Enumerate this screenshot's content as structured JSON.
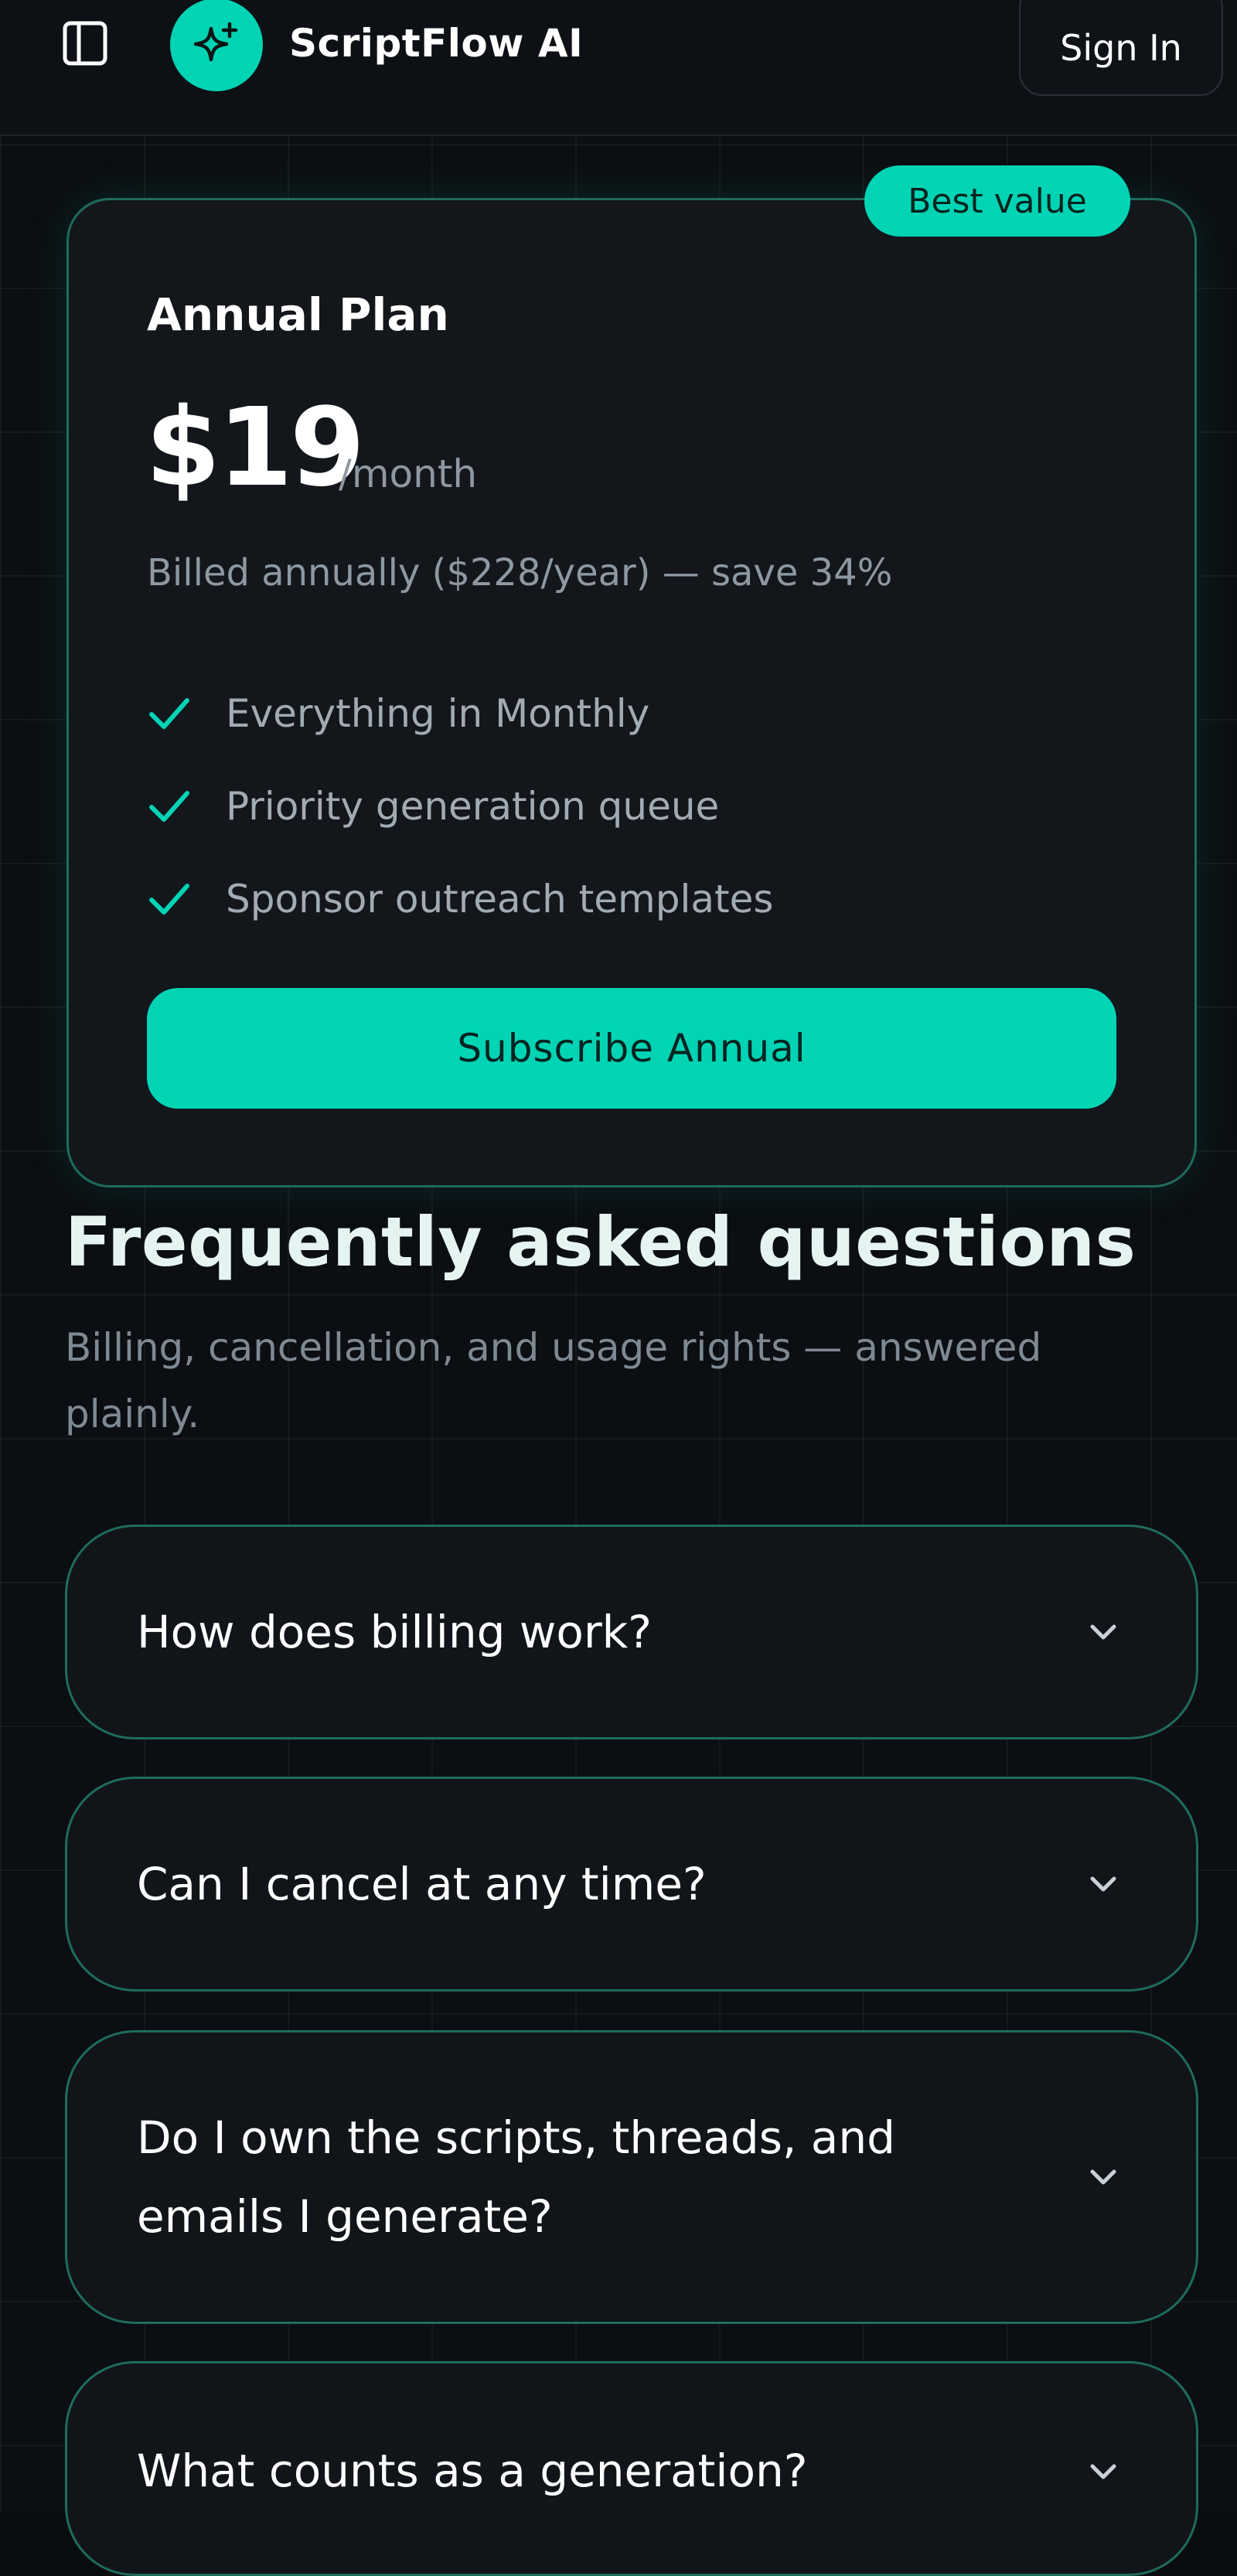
{
  "header": {
    "brand_name": "ScriptFlow AI",
    "signin_label": "Sign In"
  },
  "plan": {
    "badge": "Best value",
    "title": "Annual Plan",
    "price": "$19",
    "period": "/month",
    "billing_note": "Billed annually ($228/year) — save 34%",
    "features": [
      "Everything in Monthly",
      "Priority generation queue",
      "Sponsor outreach templates"
    ],
    "subscribe_label": "Subscribe Annual"
  },
  "faq": {
    "heading": "Frequently asked questions",
    "subtitle": "Billing, cancellation, and usage rights — answered plainly.",
    "items": [
      "How does billing work?",
      "Can I cancel at any time?",
      "Do I own the scripts, threads, and emails I generate?",
      "What counts as a generation?"
    ]
  },
  "colors": {
    "accent": "#00d4b5",
    "background": "#0b0e12",
    "card": "#13171c",
    "border": "#1f6b5d"
  },
  "icons": {
    "sidebar_toggle": "sidebar-toggle-icon",
    "logo": "sparkle-icon",
    "check": "check-icon",
    "chevron": "chevron-down-icon"
  }
}
